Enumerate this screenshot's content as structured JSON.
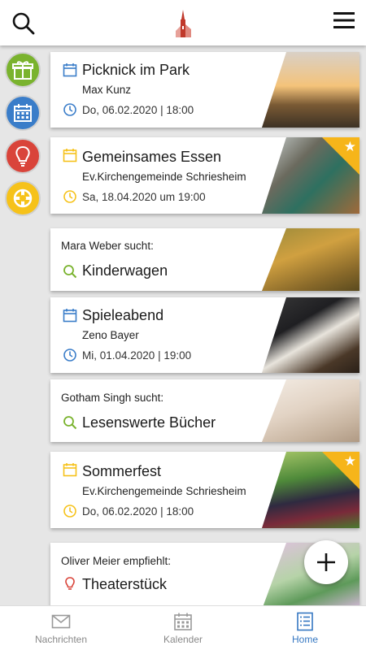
{
  "colors": {
    "accent": "#3577c2",
    "green": "#7ab32e",
    "blue": "#3a7dc9",
    "red": "#d9443a",
    "yellow": "#f6c21a"
  },
  "top": {
    "search_icon": "search-icon",
    "menu_icon": "hamburger-icon"
  },
  "cards": [
    {
      "title": "Picknick im Park",
      "sub": "Max Kunz",
      "date": "Do, 06.02.2020 | 18:00"
    },
    {
      "title": "Gemeinsames Essen",
      "sub": "Ev.Kirchengemeinde Schriesheim",
      "date": "Sa, 18.04.2020 um 19:00"
    },
    {
      "who_name": "Mara Weber",
      "who_verb": "sucht:",
      "title": "Kinderwagen"
    },
    {
      "title": "Spieleabend",
      "sub": "Zeno Bayer",
      "date": "Mi, 01.04.2020 | 19:00"
    },
    {
      "who_name": "Gotham Singh",
      "who_verb": "sucht:",
      "title": "Lesenswerte Bücher"
    },
    {
      "title": "Sommerfest",
      "sub": "Ev.Kirchengemeinde Schriesheim",
      "date": "Do, 06.02.2020 | 18:00"
    },
    {
      "who_name": "Oliver Meier",
      "who_verb": "empfiehlt:",
      "title": "Theaterstück"
    }
  ],
  "nav": [
    {
      "label": "Nachrichten"
    },
    {
      "label": "Kalender"
    },
    {
      "label": "Home"
    }
  ]
}
